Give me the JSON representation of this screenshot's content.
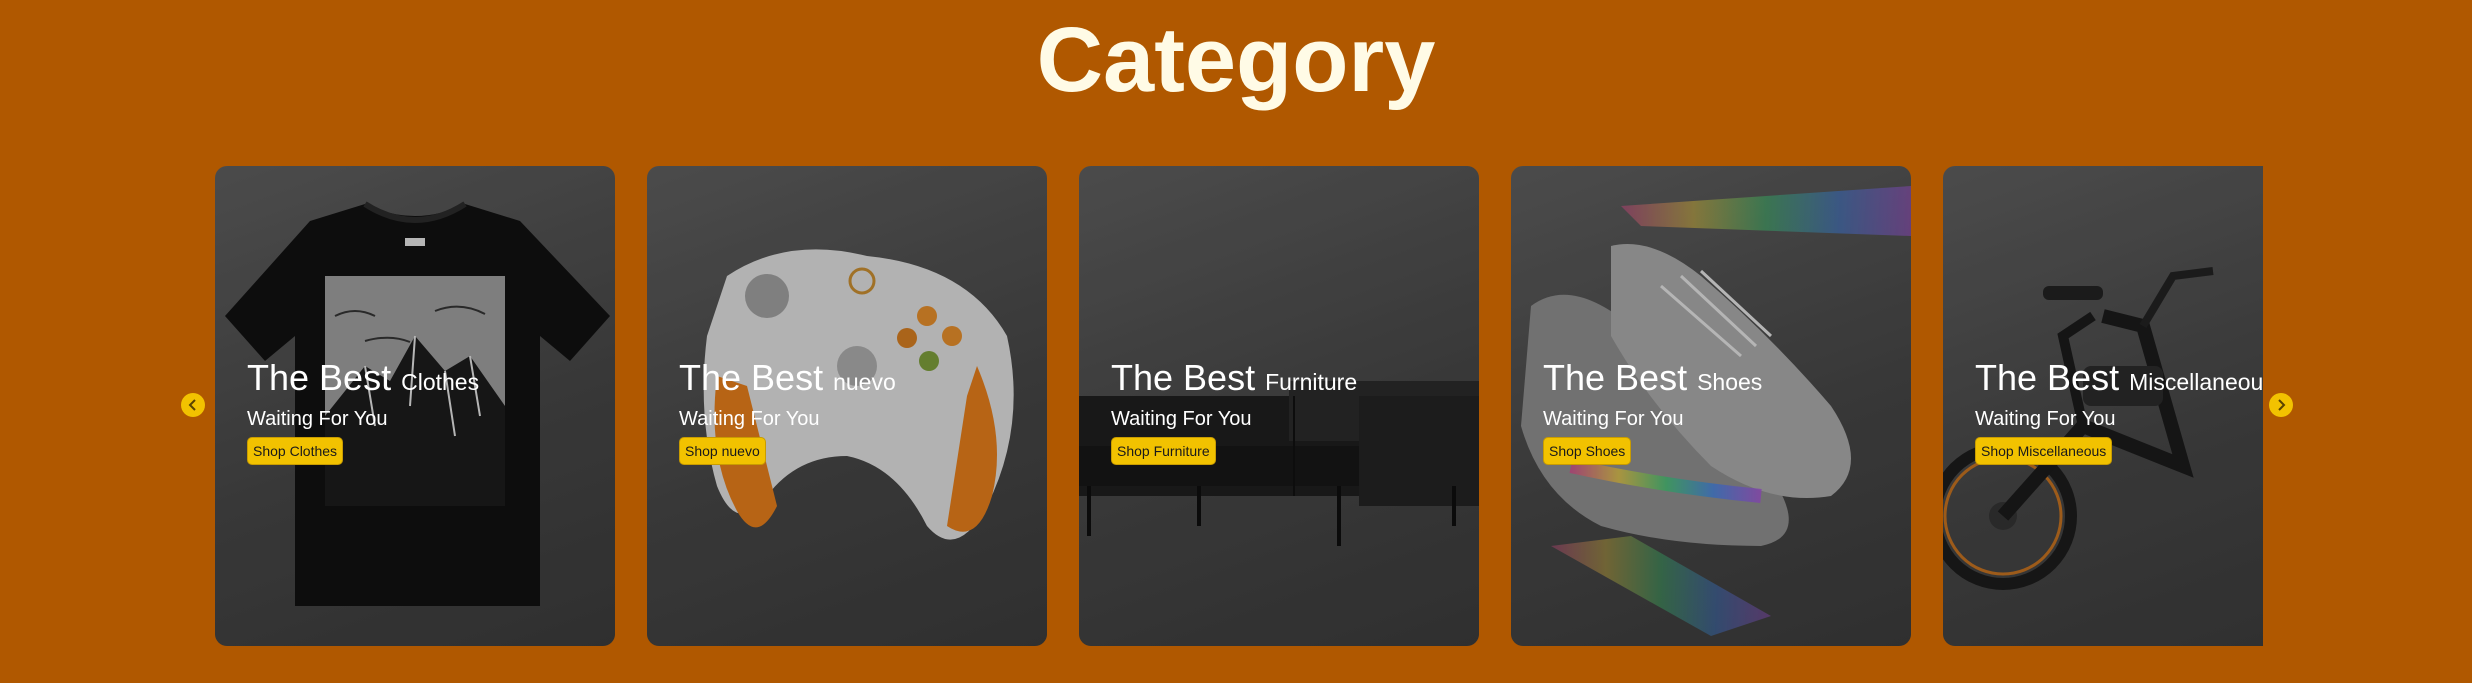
{
  "page": {
    "title": "Category"
  },
  "carousel": {
    "prev_icon": "chevron-left-icon",
    "next_icon": "chevron-right-icon",
    "cards": [
      {
        "headline": "The Best",
        "category": "Clothes",
        "subtitle": "Waiting For You",
        "button": "Shop Clothes",
        "image": "t-shirt-mountain-print"
      },
      {
        "headline": "The Best",
        "category": "nuevo",
        "subtitle": "Waiting For You",
        "button": "Shop nuevo",
        "image": "game-controller"
      },
      {
        "headline": "The Best",
        "category": "Furniture",
        "subtitle": "Waiting For You",
        "button": "Shop Furniture",
        "image": "black-leather-sofa"
      },
      {
        "headline": "The Best",
        "category": "Shoes",
        "subtitle": "Waiting For You",
        "button": "Shop Shoes",
        "image": "sneakers-rainbow"
      },
      {
        "headline": "The Best",
        "category": "Miscellaneous",
        "subtitle": "Waiting For You",
        "button": "Shop Miscellaneous",
        "image": "electric-bicycle"
      }
    ]
  },
  "colors": {
    "background": "#b05800",
    "title": "#fffbe6",
    "accent": "#f2c200",
    "card": "#4a4a4a"
  }
}
